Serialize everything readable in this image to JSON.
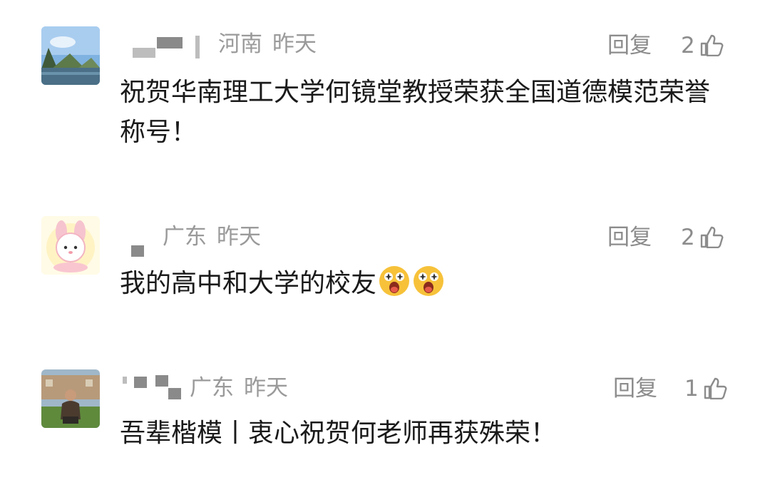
{
  "comments": [
    {
      "location": "河南",
      "time": "昨天",
      "reply_label": "回复",
      "likes": "2",
      "text": "祝贺华南理工大学何镜堂教授荣获全国道德模范荣誉称号！",
      "avatar_icon": "landscape-avatar-icon"
    },
    {
      "location": "广东",
      "time": "昨天",
      "reply_label": "回复",
      "likes": "2",
      "text": "我的高中和大学的校友",
      "emojis": [
        "surprised-face-emoji",
        "surprised-face-emoji"
      ],
      "avatar_icon": "cartoon-bunny-avatar-icon"
    },
    {
      "location": "广东",
      "time": "昨天",
      "reply_label": "回复",
      "likes": "1",
      "text": "吾辈楷模丨衷心祝贺何老师再获殊荣！",
      "avatar_icon": "person-photo-avatar-icon"
    }
  ],
  "colors": {
    "meta_gray": "#9a9a9a",
    "text_dark": "#1a1a1a",
    "background": "#ffffff"
  }
}
